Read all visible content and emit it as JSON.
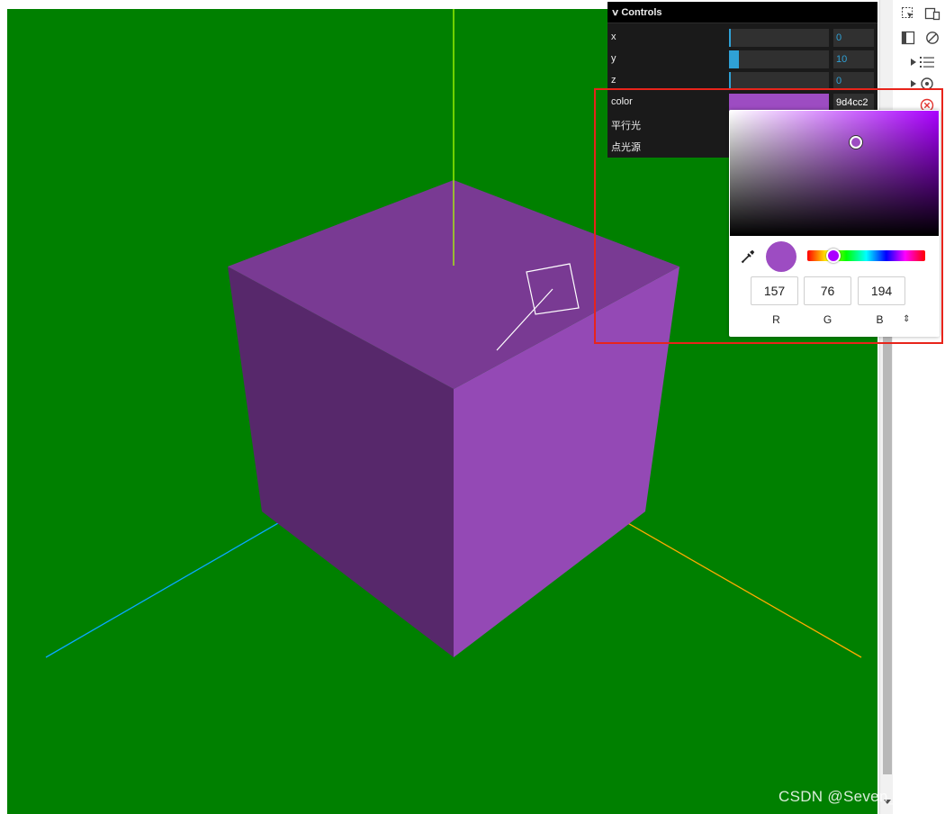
{
  "gui": {
    "title": "Controls",
    "rows": [
      {
        "label": "x",
        "value": "0",
        "fraction": 0.01
      },
      {
        "label": "y",
        "value": "10",
        "fraction": 0.1
      },
      {
        "label": "z",
        "value": "0",
        "fraction": 0.01
      },
      {
        "label": "color",
        "hex": "9d4cc2",
        "swatch": "#9d4cc2"
      },
      {
        "label": "平行光"
      },
      {
        "label": "点光源"
      }
    ]
  },
  "colorPicker": {
    "color": "#9d4cc2",
    "hueColor": "#aa00ff",
    "r": "157",
    "g": "76",
    "b": "194",
    "rLabel": "R",
    "gLabel": "G",
    "bLabel": "B",
    "modeSwitch": "⇕"
  },
  "scene": {
    "background": "#008000",
    "cube": {
      "top": "#793a93",
      "left": "#57286b",
      "right": "#9449b5"
    },
    "axes": {
      "x": "#ffaa00",
      "y": "#aaff00",
      "z": "#0aa8ff"
    }
  },
  "watermark": "CSDN @Seven_Ting"
}
